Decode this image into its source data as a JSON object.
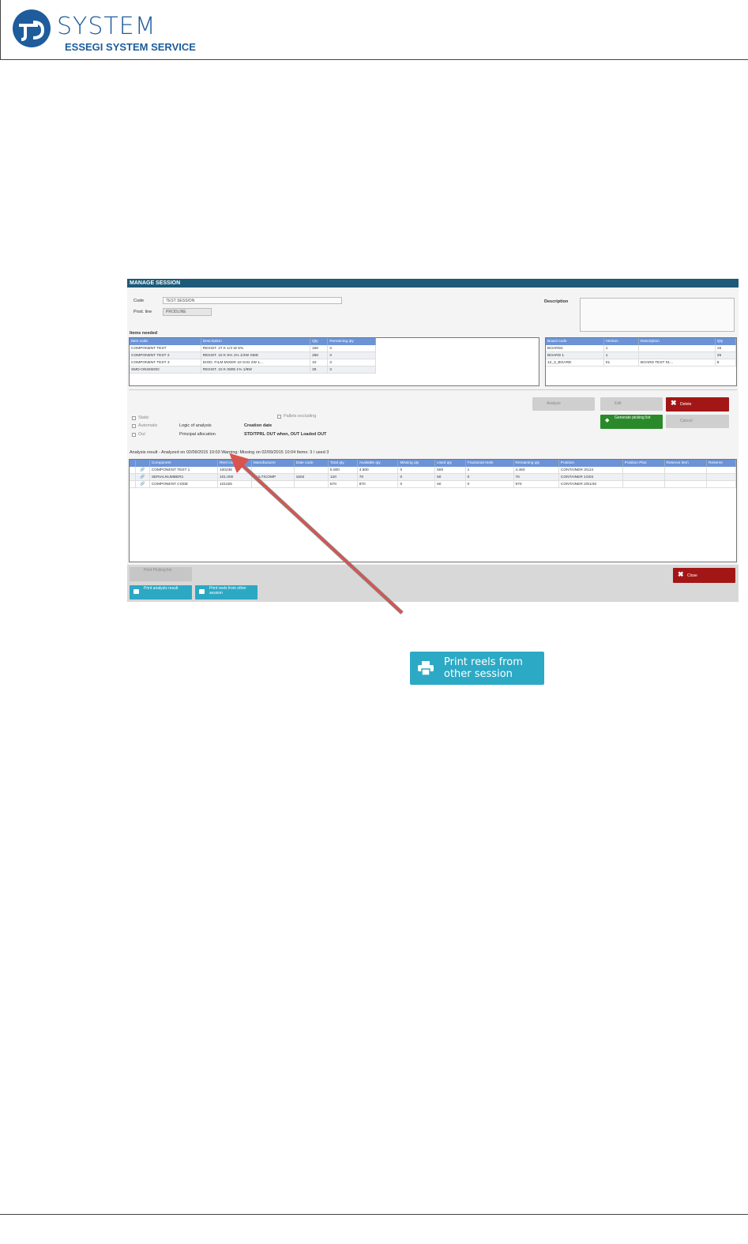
{
  "logo": {
    "word": "SYSTEM",
    "subtitle": "ESSEGI SYSTEM SERVICE"
  },
  "session": {
    "title": "MANAGE SESSION",
    "code_label": "Code",
    "code_value": "TEST SESSION",
    "prod_line_label": "Prod. line",
    "prod_line_value": "PRODLINE",
    "description_label": "Description",
    "items_needed_label": "Items needed",
    "items_columns": [
      "Item code",
      "Description",
      "Qty",
      "Remaining qty"
    ],
    "items_rows": [
      [
        "COMPONENT TEST",
        "RESIST. 27 K 1/4 W 5%",
        "150",
        "3"
      ],
      [
        "COMPONENT TEST 2",
        "RESIST. 10 K 5% 1% 1/4W SMD",
        "250",
        "3"
      ],
      [
        "COMPONENT TEST 3",
        "DIOD. FILM MIXER 10 GHz 2W 1...",
        "10",
        "3"
      ],
      [
        "SMD-ONGIMOD",
        "RESIST. 10 K 0805 1% 1/8W",
        "26",
        "3"
      ]
    ],
    "boards_columns": [
      "Board code",
      "Version",
      "Description",
      "Qty"
    ],
    "boards_rows": [
      [
        "BOARD2",
        "1",
        "",
        "15"
      ],
      [
        "BOARD 1",
        "1",
        "",
        "25"
      ],
      [
        "12_3_BOARD",
        "01",
        "BOARD TEST 01...",
        "8"
      ]
    ],
    "options": {
      "static_label": "Static",
      "automatic_label": "Automatic",
      "out_label": "Out",
      "logic_label": "Logic of analysis",
      "logic_value": "Creation date",
      "principal_label": "Principal allocation",
      "principal_value": "STD/TPRL OUT when, OUT Loaded OUT",
      "pallet_label": "Pallets excluding"
    },
    "buttons": {
      "analyze": "Analyze",
      "edit": "Edit",
      "delete": "Delete",
      "generate": "Generate picking list",
      "cancel": "Cancel",
      "print_picking": "Print Picking list",
      "print_analysis": "Print analysis result",
      "print_other": "Print reels from other session",
      "close": "Close"
    },
    "result_line": "Analysis result - Analyzed on 02/09/2015 10:03 Warning: Missing on 02/09/2015 10:04 Items: 3 / used 3",
    "result_columns": [
      "",
      "",
      "Component",
      "Reel code",
      "Manufacturer",
      "Date code",
      "Total qty",
      "Available qty",
      "Missing qty",
      "Used qty",
      "Fractional reels",
      "Remaining qty",
      "Position",
      "Position Plus",
      "Reserve item",
      "Reserve"
    ],
    "result_rows": [
      [
        "",
        "link-icon",
        "COMPONENT TEST 1",
        "100236",
        "",
        "",
        "5.000",
        "4.500",
        "0",
        "500",
        "1",
        "4.460",
        "CONTAINER 3/124",
        "",
        "",
        ""
      ],
      [
        "",
        "link-icon",
        "SERIALNUMBER1",
        "101.000",
        "MULTICOMP",
        "1502",
        "120",
        "70",
        "0",
        "50",
        "0",
        "70",
        "CONTAINER 1/204",
        "",
        "",
        ""
      ],
      [
        "",
        "link-icon",
        "COMPONENT CODE",
        "101025",
        "",
        "",
        "870",
        "870",
        "0",
        "50",
        "0",
        "870",
        "CONTAINER 2/81/40",
        "",
        "",
        ""
      ]
    ]
  },
  "callout": {
    "button_label": "Print reels from other session",
    "icon": "printer-icon"
  },
  "colors": {
    "brand": "#1e5c9c",
    "titlebar": "#1c5a78",
    "teal": "#2ca9c5",
    "arrow": "#d9534f"
  }
}
